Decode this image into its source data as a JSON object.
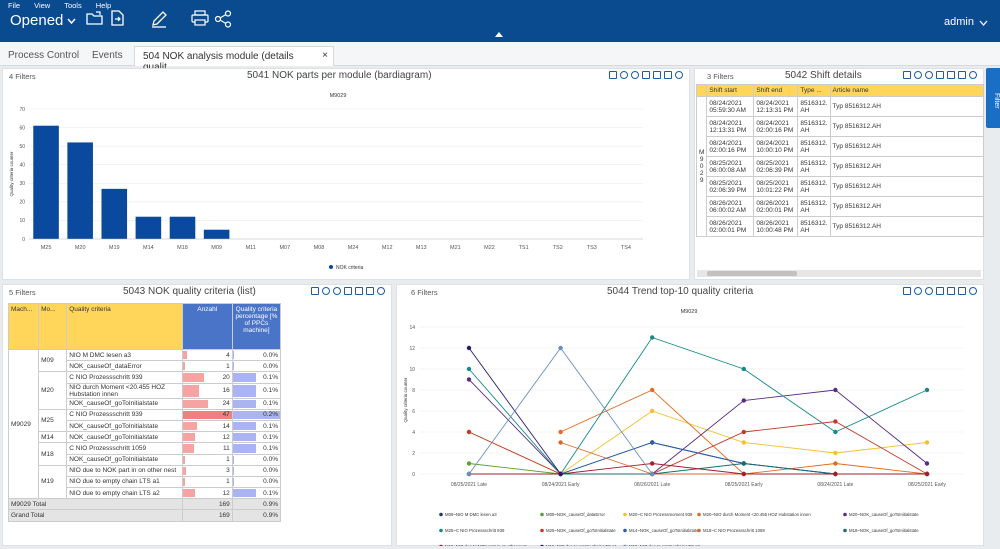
{
  "menu": [
    "File",
    "View",
    "Tools",
    "Help"
  ],
  "app_title": "Opened",
  "user": "admin",
  "tabs": [
    "Process Control",
    "Events",
    "504 NOK analysis module (details qualit..."
  ],
  "filter_tab": "Filter",
  "panels": {
    "p5041": {
      "filters": "4 Filters",
      "title": "5041 NOK parts per module (bardiagram)"
    },
    "p5042": {
      "filters": "3 Filters",
      "title": "5042 Shift details"
    },
    "p5043": {
      "filters": "5 Filters",
      "title": "5043 NOK quality criteria (list)"
    },
    "p5044": {
      "filters": "6 Filters",
      "title": "5044 Trend top-10 quality criteria"
    }
  },
  "shift_details": {
    "headers": [
      "Shift start",
      "Shift end",
      "Type ...",
      "Article name"
    ],
    "group": "M9029",
    "rows": [
      [
        "08/24/2021 05:59:30 AM",
        "08/24/2021 12:13:31 PM",
        "8516312. AH",
        "Typ 8516312.AH"
      ],
      [
        "08/24/2021 12:13:31 PM",
        "08/24/2021 02:00:16 PM",
        "8516312. AH",
        "Typ 8516312.AH"
      ],
      [
        "08/24/2021 02:00:16 PM",
        "08/24/2021 10:00:10 PM",
        "8516312. AH",
        "Typ 8516312.AH"
      ],
      [
        "08/25/2021 06:00:08 AM",
        "08/25/2021 02:06:39 PM",
        "8516312. AH",
        "Typ 8516312.AH"
      ],
      [
        "08/25/2021 02:06:39 PM",
        "08/25/2021 10:01:22 PM",
        "8516312. AH",
        "Typ 8516312.AH"
      ],
      [
        "08/26/2021 06:00:02 AM",
        "08/26/2021 02:00:01 PM",
        "8516312. AH",
        "Typ 8516312.AH"
      ],
      [
        "08/26/2021 02:00:01 PM",
        "08/26/2021 10:00:48 PM",
        "8516312. AH",
        "Typ 8516312.AH"
      ]
    ]
  },
  "quality_list": {
    "headers": [
      "Mach...",
      "Mo...",
      "Quality criteria",
      "Anzahl",
      "Quality criteria percentage [% of PPCs machine]"
    ],
    "machine": "M9029",
    "groups": [
      {
        "module": "M09",
        "rows": [
          [
            "NIO M DMC lesen a3",
            "4",
            "0.0%"
          ],
          [
            "NOK_causeOf_dataError",
            "1",
            "0.0%"
          ]
        ]
      },
      {
        "module": "M20",
        "rows": [
          [
            "C NIO Prozessschritt 939",
            "20",
            "0.1%"
          ],
          [
            "NIO durch Moment <20.455 HOZ Hubstation innen",
            "16",
            "0.1%"
          ],
          [
            "NOK_causeOf_goToInitialstate",
            "24",
            "0.1%"
          ]
        ]
      },
      {
        "module": "M25",
        "rows": [
          [
            "C NIO Prozessschritt 939",
            "47",
            "0.2%"
          ],
          [
            "NOK_causeOf_goToInitialstate",
            "14",
            "0.1%"
          ]
        ]
      },
      {
        "module": "M14",
        "rows": [
          [
            "NOK_causeOf_goToInitialstate",
            "12",
            "0.1%"
          ]
        ]
      },
      {
        "module": "M18",
        "rows": [
          [
            "C NIO Prozessschritt 1059",
            "11",
            "0.1%"
          ],
          [
            "NOK_causeOf_goToInitialstate",
            "1",
            "0.0%"
          ]
        ]
      },
      {
        "module": "M19",
        "rows": [
          [
            "NIO due to NOK part in on other nest",
            "3",
            "0.0%"
          ],
          [
            "NIO due to empty chain LTS a1",
            "1",
            "0.0%"
          ],
          [
            "NIO due to empty chain LTS a2",
            "12",
            "0.1%"
          ]
        ]
      }
    ],
    "totals": [
      [
        "M9029 Total",
        "169",
        "0.9%"
      ],
      [
        "Grand Total",
        "169",
        "0.9%"
      ]
    ]
  },
  "chart_data": [
    {
      "type": "bar",
      "subtitle": "M9029",
      "ylabel": "Quality criteria counter",
      "ylim": [
        0,
        70
      ],
      "yticks": [
        "0",
        "10",
        "20",
        "30",
        "40",
        "50",
        "60",
        "70"
      ],
      "categories": [
        "M25",
        "M20",
        "M19",
        "M14",
        "M18",
        "M09",
        "M11",
        "M07",
        "M08",
        "M24",
        "M12",
        "M13",
        "M21",
        "M22",
        "TS1",
        "TS2",
        "TS3",
        "TS4"
      ],
      "series": [
        {
          "name": "NOK criteria",
          "values": [
            61,
            52,
            27,
            12,
            12,
            5,
            0,
            0,
            0,
            0,
            0,
            0,
            0,
            0,
            0,
            0,
            0,
            0
          ]
        }
      ],
      "color": "#0a4a9e",
      "grid": true
    },
    {
      "type": "line",
      "subtitle": "M9029",
      "ylabel": "Quality criteria counter",
      "ylim": [
        0,
        14
      ],
      "yticks": [
        "0",
        "2",
        "4",
        "6",
        "8",
        "10",
        "12",
        "14"
      ],
      "x": [
        "08/25/2021 Late",
        "08/24/2021 Early",
        "08/26/2021 Late",
        "08/25/2021 Early",
        "08/24/2021 Late",
        "08/25/2021 Early"
      ],
      "series": [
        {
          "name": "M09~NIO M DMC lesen a3",
          "color": "#1f3a7a",
          "values": [
            null,
            0,
            3,
            1,
            0,
            0
          ]
        },
        {
          "name": "M09~NOK_causeOf_dataError",
          "color": "#5aa02c",
          "values": [
            1,
            0,
            null,
            null,
            null,
            null
          ]
        },
        {
          "name": "M20~C NIO Prozessmoment 939",
          "color": "#f2c12e",
          "values": [
            4,
            0,
            6,
            3,
            2,
            3
          ]
        },
        {
          "name": "M20~NIO durch Moment <20.455 HOZ Hubstation innen",
          "color": "#e36c1e",
          "values": [
            null,
            4,
            8,
            0,
            1,
            0
          ]
        },
        {
          "name": "M20~NOK_causeOf_goToInitialstate",
          "color": "#5b2a86",
          "values": [
            9,
            0,
            0,
            7,
            8,
            1
          ]
        },
        {
          "name": "M25~C NIO Prozessschritt 939",
          "color": "#168a8a",
          "values": [
            10,
            0,
            13,
            10,
            4,
            8
          ]
        },
        {
          "name": "M25~NOK_causeOf_goToInitialstate",
          "color": "#c0392b",
          "values": [
            4,
            0,
            0,
            4,
            5,
            0
          ]
        },
        {
          "name": "M14~NOK_causeOf_goToInitialstate",
          "color": "#2b5ea8",
          "values": [
            0,
            0,
            3,
            1,
            0,
            0
          ]
        },
        {
          "name": "M18~C NIO Prozessschritt 1059",
          "color": "#d9682c",
          "values": [
            null,
            3,
            0,
            0,
            0,
            0
          ]
        },
        {
          "name": "M18~NOK_causeOf_goToInitialstate",
          "color": "#1b6e6e",
          "values": [
            null,
            0,
            0,
            1,
            0,
            0
          ]
        },
        {
          "name": "M19~NIO due to NOK part in on other nest",
          "color": "#a11e2e",
          "values": [
            0,
            0,
            1,
            0,
            0,
            0
          ]
        },
        {
          "name": "M19~NIO due to empty chain LTS a1",
          "color": "#2a1a6e",
          "values": [
            12,
            0,
            null,
            null,
            null,
            null
          ]
        },
        {
          "name": "M19~NIO due to empty chain LTS a2",
          "color": "#6c8ebf",
          "values": [
            0,
            12,
            0,
            null,
            null,
            null
          ]
        }
      ],
      "grid": true
    }
  ]
}
